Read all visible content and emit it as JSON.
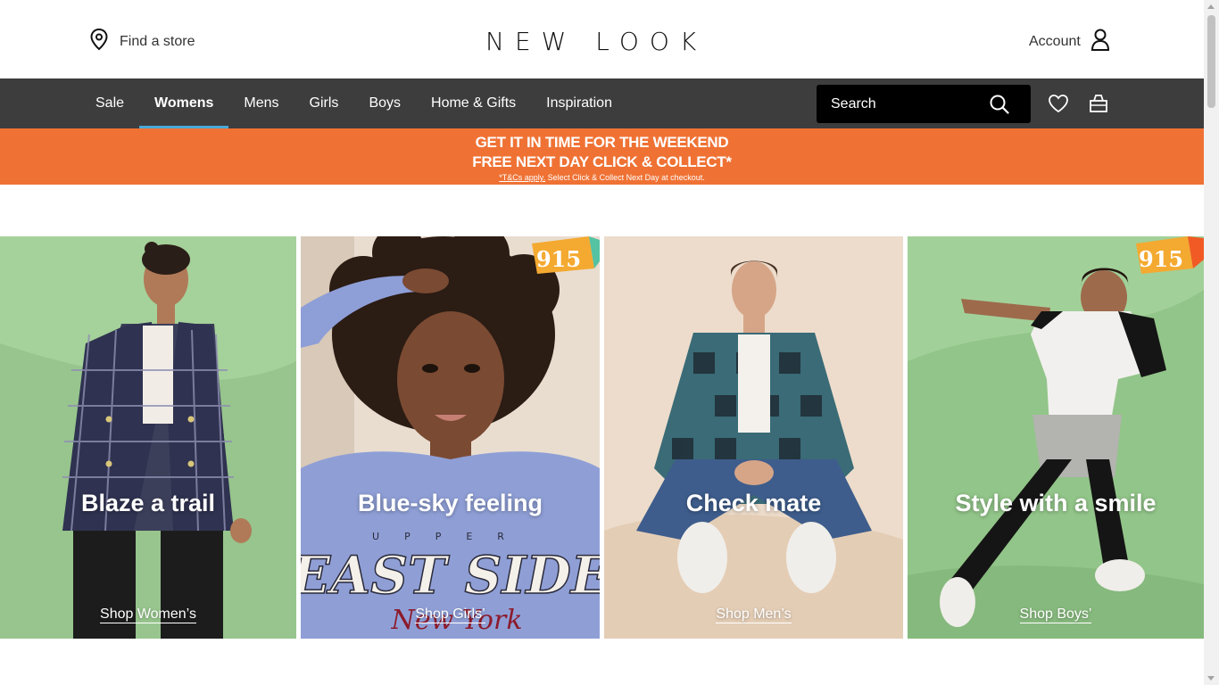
{
  "header": {
    "find_store": "Find a store",
    "logo": "NEW LOOK",
    "account": "Account"
  },
  "nav": {
    "items": [
      {
        "label": "Sale"
      },
      {
        "label": "Womens",
        "active": true
      },
      {
        "label": "Mens"
      },
      {
        "label": "Girls"
      },
      {
        "label": "Boys"
      },
      {
        "label": "Home & Gifts"
      },
      {
        "label": "Inspiration"
      }
    ],
    "search_placeholder": "Search",
    "icons": [
      "search-icon",
      "heart-icon",
      "bag-icon"
    ]
  },
  "promo": {
    "line1": "GET IT IN TIME FOR THE WEEKEND",
    "line2": "FREE NEXT DAY CLICK & COLLECT*",
    "tcs_link": "*T&Cs apply.",
    "tcs_text": " Select Click & Collect Next Day at checkout.",
    "bg": "#ef7234"
  },
  "tiles": [
    {
      "title": "Blaze a trail",
      "link": "Shop Women’s"
    },
    {
      "title": "Blue-sky feeling",
      "link": "Shop Girls’",
      "badge": "915",
      "graphic_text_top": "UPPER",
      "graphic_text": "EAST SIDE",
      "graphic_script": "New York"
    },
    {
      "title": "Check mate",
      "link": "Shop Men’s"
    },
    {
      "title": "Style with a smile",
      "link": "Shop Boys’",
      "badge": "915"
    }
  ],
  "colors": {
    "nav_bg": "#3d3d3d",
    "active_underline": "#4aa9d9",
    "search_bg": "#000000",
    "tile_green": "#95c78c",
    "tile_lilac": "#8f9fd6",
    "tile_beige": "#ead9c7"
  }
}
